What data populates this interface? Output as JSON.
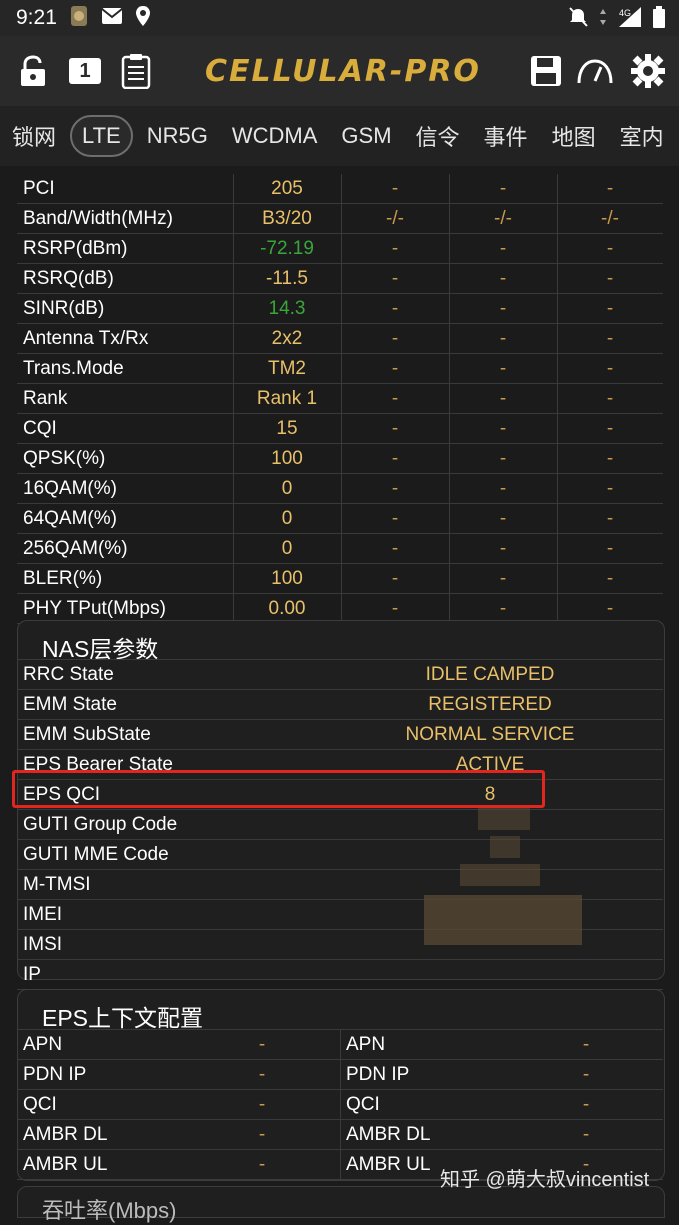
{
  "status": {
    "time": "9:21",
    "network": "4G"
  },
  "toolbar": {
    "logo": "CELLULAR-PRO",
    "sim_number": "1"
  },
  "tabs": [
    "锁网",
    "LTE",
    "NR5G",
    "WCDMA",
    "GSM",
    "信令",
    "事件",
    "地图",
    "室内"
  ],
  "lte_rows": [
    {
      "label": "PCI",
      "v1": "205",
      "v2": "-",
      "v3": "-",
      "v4": "-"
    },
    {
      "label": "Band/Width(MHz)",
      "v1": "B3/20",
      "v2": "-/-",
      "v3": "-/-",
      "v4": "-/-"
    },
    {
      "label": "RSRP(dBm)",
      "v1": "-72.19",
      "v2": "-",
      "v3": "-",
      "v4": "-"
    },
    {
      "label": "RSRQ(dB)",
      "v1": "-11.5",
      "v2": "-",
      "v3": "-",
      "v4": "-"
    },
    {
      "label": "SINR(dB)",
      "v1": "14.3",
      "v2": "-",
      "v3": "-",
      "v4": "-"
    },
    {
      "label": "Antenna Tx/Rx",
      "v1": "2x2",
      "v2": "-",
      "v3": "-",
      "v4": "-"
    },
    {
      "label": "Trans.Mode",
      "v1": "TM2",
      "v2": "-",
      "v3": "-",
      "v4": "-"
    },
    {
      "label": "Rank",
      "v1": "Rank 1",
      "v2": "-",
      "v3": "-",
      "v4": "-"
    },
    {
      "label": "CQI",
      "v1": "15",
      "v2": "-",
      "v3": "-",
      "v4": "-"
    },
    {
      "label": "QPSK(%)",
      "v1": "100",
      "v2": "-",
      "v3": "-",
      "v4": "-"
    },
    {
      "label": "16QAM(%)",
      "v1": "0",
      "v2": "-",
      "v3": "-",
      "v4": "-"
    },
    {
      "label": "64QAM(%)",
      "v1": "0",
      "v2": "-",
      "v3": "-",
      "v4": "-"
    },
    {
      "label": "256QAM(%)",
      "v1": "0",
      "v2": "-",
      "v3": "-",
      "v4": "-"
    },
    {
      "label": "BLER(%)",
      "v1": "100",
      "v2": "-",
      "v3": "-",
      "v4": "-"
    },
    {
      "label": "PHY TPut(Mbps)",
      "v1": "0.00",
      "v2": "-",
      "v3": "-",
      "v4": "-"
    }
  ],
  "nas": {
    "title": "NAS层参数",
    "rows": [
      {
        "label": "RRC State",
        "value": "IDLE CAMPED"
      },
      {
        "label": "EMM State",
        "value": "REGISTERED"
      },
      {
        "label": "EMM SubState",
        "value": "NORMAL SERVICE"
      },
      {
        "label": "EPS Bearer State",
        "value": "ACTIVE"
      },
      {
        "label": "EPS QCI",
        "value": "8"
      },
      {
        "label": "GUTI Group Code",
        "value": ""
      },
      {
        "label": "GUTI MME Code",
        "value": ""
      },
      {
        "label": "M-TMSI",
        "value": ""
      },
      {
        "label": "IMEI",
        "value": ""
      },
      {
        "label": "IMSI",
        "value": ""
      },
      {
        "label": "IP",
        "value": ""
      }
    ]
  },
  "eps": {
    "title": "EPS上下文配置",
    "rows": [
      {
        "l1": "APN",
        "v1": "-",
        "l2": "APN",
        "v2": "-"
      },
      {
        "l1": "PDN IP",
        "v1": "-",
        "l2": "PDN IP",
        "v2": "-"
      },
      {
        "l1": "QCI",
        "v1": "-",
        "l2": "QCI",
        "v2": "-"
      },
      {
        "l1": "AMBR DL",
        "v1": "-",
        "l2": "AMBR DL",
        "v2": "-"
      },
      {
        "l1": "AMBR UL",
        "v1": "-",
        "l2": "AMBR UL",
        "v2": "-"
      }
    ]
  },
  "watermark": "知乎 @萌大叔vincentist",
  "next_section_peek": "吞吐率(Mbps)",
  "colors": {
    "accent": "#e8c06a",
    "green": "#3aa63a",
    "highlight": "#e0261e"
  }
}
